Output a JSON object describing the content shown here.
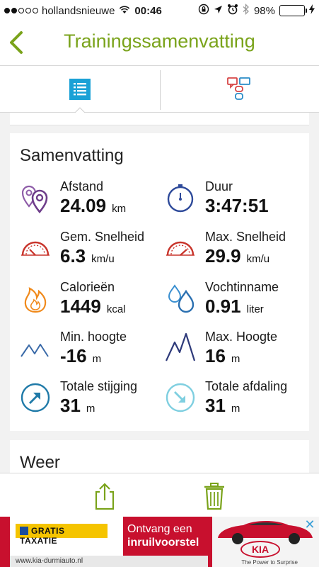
{
  "status_bar": {
    "carrier": "hollandsnieuwe",
    "time": "00:46",
    "battery": "98%",
    "signal_bars_filled": 2,
    "signal_bars_total": 5
  },
  "nav": {
    "title": "Trainingssamenvatting",
    "accent_color": "#7aa31b"
  },
  "tabs": [
    {
      "name": "summary-list",
      "icon": "list-icon",
      "selected": true
    },
    {
      "name": "comments",
      "icon": "chat-bubbles-icon",
      "selected": false
    }
  ],
  "summary": {
    "title": "Samenvatting",
    "stats": [
      {
        "key": "distance",
        "label": "Afstand",
        "value": "24.09",
        "unit": "km",
        "icon": "location-pins-icon"
      },
      {
        "key": "duration",
        "label": "Duur",
        "value": "3:47:51",
        "unit": "",
        "icon": "stopwatch-icon"
      },
      {
        "key": "avg_speed",
        "label": "Gem. Snelheid",
        "value": "6.3",
        "unit": "km/u",
        "icon": "speedometer-icon"
      },
      {
        "key": "max_speed",
        "label": "Max. Snelheid",
        "value": "29.9",
        "unit": "km/u",
        "icon": "speedometer-max-icon"
      },
      {
        "key": "calories",
        "label": "Calorieën",
        "value": "1449",
        "unit": "kcal",
        "icon": "flame-icon"
      },
      {
        "key": "hydration",
        "label": "Vochtinname",
        "value": "0.91",
        "unit": "liter",
        "icon": "water-drops-icon"
      },
      {
        "key": "min_altitude",
        "label": "Min. hoogte",
        "value": "-16",
        "unit": "m",
        "icon": "mountain-low-icon"
      },
      {
        "key": "max_altitude",
        "label": "Max. Hoogte",
        "value": "16",
        "unit": "m",
        "icon": "mountain-high-icon"
      },
      {
        "key": "total_ascent",
        "label": "Totale stijging",
        "value": "31",
        "unit": "m",
        "icon": "arrow-up-right-icon"
      },
      {
        "key": "total_descent",
        "label": "Totale afdaling",
        "value": "31",
        "unit": "m",
        "icon": "arrow-down-right-icon"
      }
    ]
  },
  "weather": {
    "title": "Weer"
  },
  "toolbar": {
    "share_icon": "share-icon",
    "delete_icon": "trash-icon"
  },
  "ad": {
    "badge": "GRATIS TAXATIE",
    "line1": "Ontvang een",
    "line2": "inruilvoorstel",
    "url": "www.kia-durmiauto.nl",
    "brand": "KIA",
    "slogan": "The Power to Surprise"
  }
}
